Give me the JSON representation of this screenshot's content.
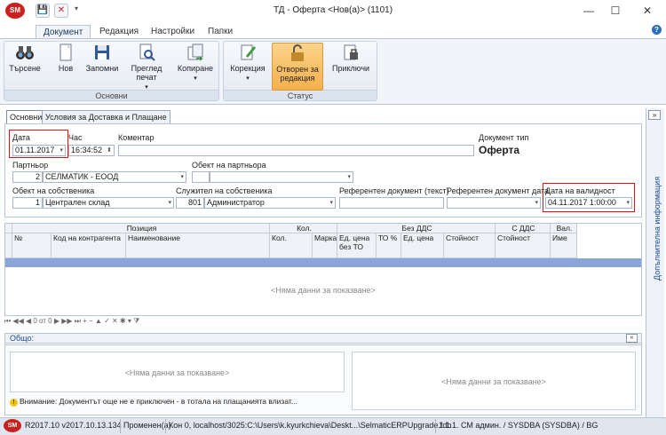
{
  "window": {
    "title": "ТД - Оферта <Нов(а)> (1101)",
    "logo": "SM",
    "quick_access": [
      "save-icon",
      "close-icon"
    ],
    "quick_access_dropdown": "▾",
    "minimize": "—",
    "maximize": "☐",
    "close": "✕"
  },
  "ribbon_tabs": [
    "Документ",
    "Редакция",
    "Настройки",
    "Папки"
  ],
  "ribbon": {
    "group_main": {
      "label": "Основни",
      "buttons": [
        "Търсене",
        "Нов",
        "Запомни",
        "Преглед печат",
        "Копиране"
      ]
    },
    "group_status": {
      "label": "Статус",
      "buttons": [
        "Корекция",
        "Отворен за редакция",
        "Приключи"
      ]
    }
  },
  "doc_tabs": [
    "Основни",
    "Условия за Доставка и Плащане"
  ],
  "form": {
    "date_label": "Дата",
    "date_value": "01.11.2017",
    "time_label": "Час",
    "time_value": "16:34:52",
    "comment_label": "Коментар",
    "comment_value": "",
    "doc_type_label": "Документ тип",
    "doc_type_value": "Оферта",
    "partner_label": "Партньор",
    "partner_id": "2",
    "partner_name": "СЕЛМАТИК - ЕООД",
    "partner_object_label": "Обект на партньора",
    "owner_object_label": "Обект на собственика",
    "owner_object_id": "1",
    "owner_object_name": "Централен склад",
    "owner_employee_label": "Служител на собственика",
    "owner_employee_id": "801",
    "owner_employee_name": "Администратор",
    "ref_doc_text_label": "Референтен документ (текст)",
    "ref_doc_date_label": "Референтен документ дата",
    "valid_date_label": "Дата на валидност",
    "valid_date_value": "04.11.2017 1:00:00"
  },
  "side_panel": {
    "toggle": "»",
    "title": "Допълнителна информация"
  },
  "grid": {
    "group_headers": [
      "Позиция",
      "Кол.",
      "Без ДДС",
      "С ДДС",
      "Вал."
    ],
    "columns": [
      "№",
      "Код на контрагента",
      "Наименование",
      "Кол.",
      "Марка",
      "Ед. цена без ТО",
      "ТО %",
      "Ед. цена",
      "Стойност",
      "Стойност",
      "Име"
    ],
    "empty_text": "<Няма данни за показване>",
    "navigator": "⏮ ◀◀ ◀  0 от 0  ▶ ▶▶ ⏭ + − ▲ ✓ ✕ ✱ ▾ ⧩"
  },
  "summary": {
    "label": "Общо:",
    "collapse": "«",
    "left_empty": "<Няма данни за показване>",
    "right_empty": "<Няма данни за показване>",
    "warning": "Внимание: Документът още не е приключен - в тотала на плащанията влизат..."
  },
  "statusbar": {
    "logo": "SM",
    "version": "R2017.10 v2017.10.13.134",
    "state": "Променен(а)",
    "connection": "Кон 0, localhost/3025:C:\\Users\\k.kyurkchieva\\Deskt...\\SelmaticERPUpgrade.fdb",
    "user": "1.1.1. СМ админ. / SYSDBA (SYSDBA) / BG"
  }
}
